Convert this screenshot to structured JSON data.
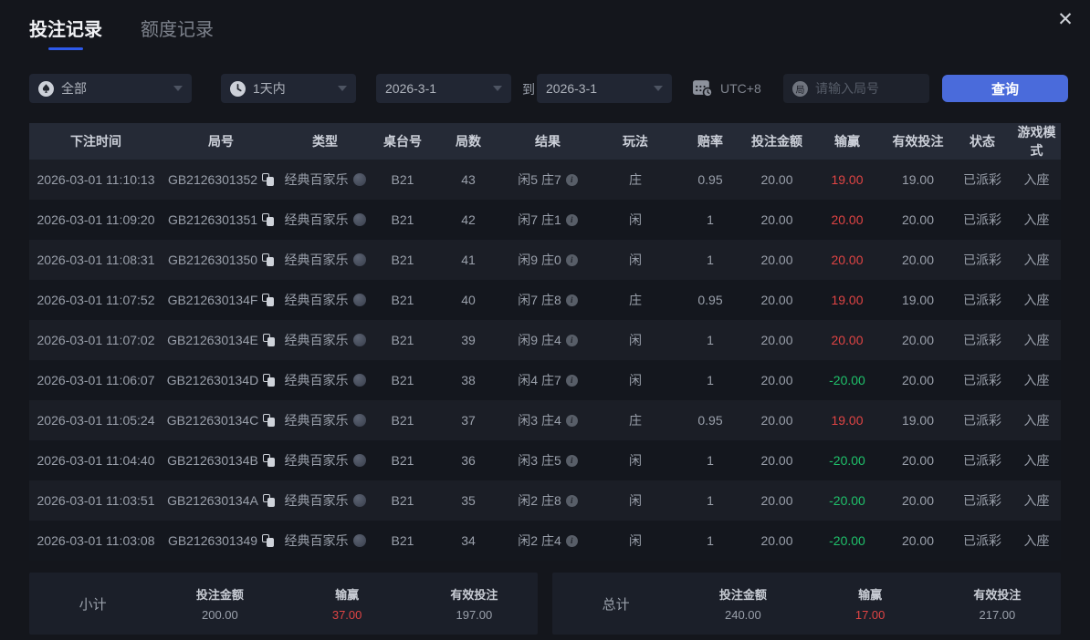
{
  "tabs": [
    {
      "label": "投注记录",
      "active": true
    },
    {
      "label": "额度记录",
      "active": false
    }
  ],
  "close_label": "✕",
  "filters": {
    "game_type": "全部",
    "time_range": "1天内",
    "date_from": "2026-3-1",
    "to_label": "到",
    "date_to": "2026-3-1",
    "timezone": "UTC+8",
    "search_icon_char": "局",
    "search_placeholder": "请输入局号",
    "query_button": "查询"
  },
  "table": {
    "headers": [
      "下注时间",
      "局号",
      "类型",
      "桌台号",
      "局数",
      "结果",
      "玩法",
      "赔率",
      "投注金额",
      "输赢",
      "有效投注",
      "状态",
      "游戏模式"
    ],
    "rows": [
      {
        "time": "2026-03-01 11:10:13",
        "round_id": "GB2126301352",
        "type": "经典百家乐",
        "table_no": "B21",
        "round_no": "43",
        "result": "闲5 庄7",
        "play": "庄",
        "odds": "0.95",
        "bet": "20.00",
        "win_lose": "19.00",
        "valid_bet": "19.00",
        "status": "已派彩",
        "mode": "入座"
      },
      {
        "time": "2026-03-01 11:09:20",
        "round_id": "GB2126301351",
        "type": "经典百家乐",
        "table_no": "B21",
        "round_no": "42",
        "result": "闲7 庄1",
        "play": "闲",
        "odds": "1",
        "bet": "20.00",
        "win_lose": "20.00",
        "valid_bet": "20.00",
        "status": "已派彩",
        "mode": "入座"
      },
      {
        "time": "2026-03-01 11:08:31",
        "round_id": "GB2126301350",
        "type": "经典百家乐",
        "table_no": "B21",
        "round_no": "41",
        "result": "闲9 庄0",
        "play": "闲",
        "odds": "1",
        "bet": "20.00",
        "win_lose": "20.00",
        "valid_bet": "20.00",
        "status": "已派彩",
        "mode": "入座"
      },
      {
        "time": "2026-03-01 11:07:52",
        "round_id": "GB212630134F",
        "type": "经典百家乐",
        "table_no": "B21",
        "round_no": "40",
        "result": "闲7 庄8",
        "play": "庄",
        "odds": "0.95",
        "bet": "20.00",
        "win_lose": "19.00",
        "valid_bet": "19.00",
        "status": "已派彩",
        "mode": "入座"
      },
      {
        "time": "2026-03-01 11:07:02",
        "round_id": "GB212630134E",
        "type": "经典百家乐",
        "table_no": "B21",
        "round_no": "39",
        "result": "闲9 庄4",
        "play": "闲",
        "odds": "1",
        "bet": "20.00",
        "win_lose": "20.00",
        "valid_bet": "20.00",
        "status": "已派彩",
        "mode": "入座"
      },
      {
        "time": "2026-03-01 11:06:07",
        "round_id": "GB212630134D",
        "type": "经典百家乐",
        "table_no": "B21",
        "round_no": "38",
        "result": "闲4 庄7",
        "play": "闲",
        "odds": "1",
        "bet": "20.00",
        "win_lose": "-20.00",
        "valid_bet": "20.00",
        "status": "已派彩",
        "mode": "入座"
      },
      {
        "time": "2026-03-01 11:05:24",
        "round_id": "GB212630134C",
        "type": "经典百家乐",
        "table_no": "B21",
        "round_no": "37",
        "result": "闲3 庄4",
        "play": "庄",
        "odds": "0.95",
        "bet": "20.00",
        "win_lose": "19.00",
        "valid_bet": "19.00",
        "status": "已派彩",
        "mode": "入座"
      },
      {
        "time": "2026-03-01 11:04:40",
        "round_id": "GB212630134B",
        "type": "经典百家乐",
        "table_no": "B21",
        "round_no": "36",
        "result": "闲3 庄5",
        "play": "闲",
        "odds": "1",
        "bet": "20.00",
        "win_lose": "-20.00",
        "valid_bet": "20.00",
        "status": "已派彩",
        "mode": "入座"
      },
      {
        "time": "2026-03-01 11:03:51",
        "round_id": "GB212630134A",
        "type": "经典百家乐",
        "table_no": "B21",
        "round_no": "35",
        "result": "闲2 庄8",
        "play": "闲",
        "odds": "1",
        "bet": "20.00",
        "win_lose": "-20.00",
        "valid_bet": "20.00",
        "status": "已派彩",
        "mode": "入座"
      },
      {
        "time": "2026-03-01 11:03:08",
        "round_id": "GB2126301349",
        "type": "经典百家乐",
        "table_no": "B21",
        "round_no": "34",
        "result": "闲2 庄4",
        "play": "闲",
        "odds": "1",
        "bet": "20.00",
        "win_lose": "-20.00",
        "valid_bet": "20.00",
        "status": "已派彩",
        "mode": "入座"
      }
    ]
  },
  "summary": {
    "subtotal": {
      "label": "小计",
      "bet_label": "投注金额",
      "bet": "200.00",
      "winlose_label": "输赢",
      "winlose": "37.00",
      "valid_label": "有效投注",
      "valid": "197.00"
    },
    "total": {
      "label": "总计",
      "bet_label": "投注金额",
      "bet": "240.00",
      "winlose_label": "输赢",
      "winlose": "17.00",
      "valid_label": "有效投注",
      "valid": "217.00"
    }
  },
  "colors": {
    "accent_blue": "#4a6bdb",
    "accent_underline": "#2e5aec",
    "win_red": "#e04444",
    "lose_green": "#1fc06a"
  }
}
